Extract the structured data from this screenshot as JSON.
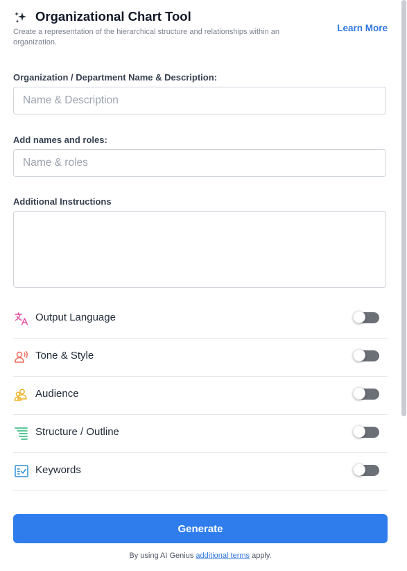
{
  "header": {
    "title": "Organizational Chart Tool",
    "subtitle": "Create a representation of the hierarchical structure and relationships within an organization.",
    "learn_more": "Learn More"
  },
  "fields": {
    "org": {
      "label": "Organization / Department Name & Description:",
      "placeholder": "Name & Description",
      "value": ""
    },
    "names": {
      "label": "Add names and roles:",
      "placeholder": "Name & roles",
      "value": ""
    },
    "instructions": {
      "label": "Additional Instructions",
      "placeholder": "",
      "value": ""
    }
  },
  "options": [
    {
      "label": "Output Language",
      "icon": "translate-icon",
      "enabled": false
    },
    {
      "label": "Tone & Style",
      "icon": "tone-icon",
      "enabled": false
    },
    {
      "label": "Audience",
      "icon": "audience-icon",
      "enabled": false
    },
    {
      "label": "Structure / Outline",
      "icon": "outline-icon",
      "enabled": false
    },
    {
      "label": "Keywords",
      "icon": "keywords-icon",
      "enabled": false
    }
  ],
  "generate_label": "Generate",
  "terms": {
    "prefix": "By using AI Genius ",
    "link": "additional terms",
    "suffix": " apply."
  },
  "colors": {
    "accent": "#2f7ded",
    "link": "#2f76e0",
    "translate": "#e04fa0",
    "tone": "#f06a5a",
    "audience": "#f0b323",
    "outline": "#22b573",
    "keywords": "#2c8fd6"
  }
}
